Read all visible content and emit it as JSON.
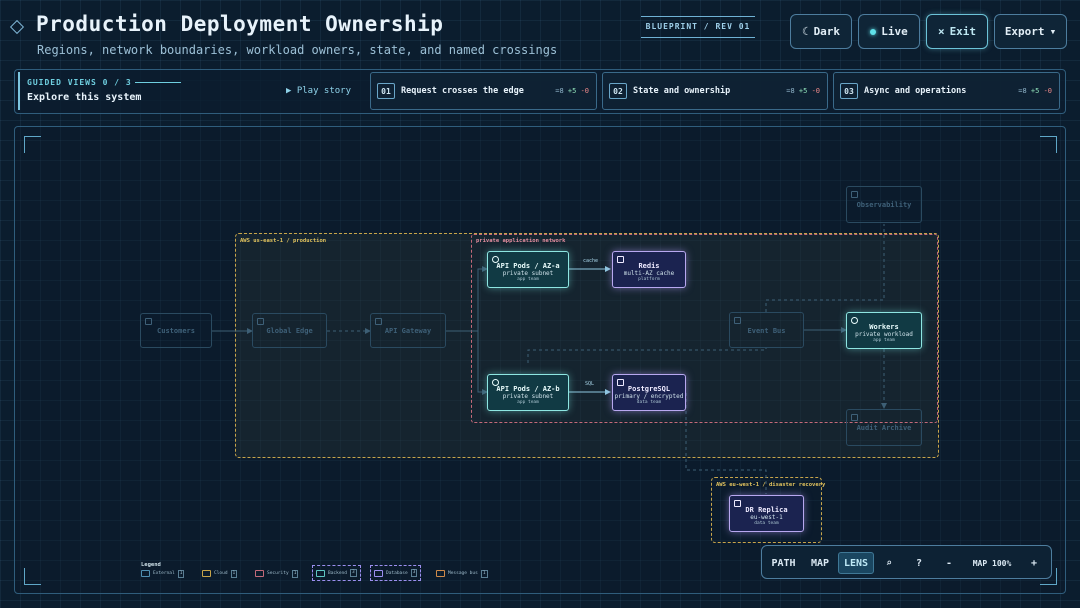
{
  "header": {
    "title": "Production Deployment Ownership",
    "subtitle": "Regions, network boundaries, workload owners, state, and named crossings",
    "revision": "BLUEPRINT / REV 01",
    "buttons": {
      "dark": "Dark",
      "dark_icon": "☾",
      "live": "Live",
      "exit": "Exit",
      "exit_icon": "×",
      "export": "Export",
      "export_icon": "▾"
    }
  },
  "guided": {
    "label": "GUIDED VIEWS 0 / 3",
    "heading": "Explore this system",
    "play": "▶ Play story",
    "steps": [
      {
        "num": "01",
        "label": "Request crosses the edge",
        "eq": "=8",
        "plus": "+5",
        "minus": "-0"
      },
      {
        "num": "02",
        "label": "State and ownership",
        "eq": "=8",
        "plus": "+5",
        "minus": "-0"
      },
      {
        "num": "03",
        "label": "Async and operations",
        "eq": "=8",
        "plus": "+5",
        "minus": "-0"
      }
    ]
  },
  "diagram": {
    "regions": {
      "us_east": "AWS us-east-1 / production",
      "eu_west": "AWS eu-west-1 / disaster recovery",
      "private_net": "private application network"
    },
    "nodes": {
      "customers": {
        "title": "Customers"
      },
      "global_edge": {
        "title": "Global Edge"
      },
      "api_gateway": {
        "title": "API Gateway"
      },
      "api_pods_a": {
        "title": "API Pods / AZ-a",
        "sub": "private subnet",
        "owner": "app team"
      },
      "redis": {
        "title": "Redis",
        "sub": "multi-AZ cache",
        "owner": "platform"
      },
      "api_pods_b": {
        "title": "API Pods / AZ-b",
        "sub": "private subnet",
        "owner": "app team"
      },
      "postgres": {
        "title": "PostgreSQL",
        "sub": "primary / encrypted",
        "owner": "data team"
      },
      "event_bus": {
        "title": "Event Bus"
      },
      "workers": {
        "title": "Workers",
        "sub": "private workload",
        "owner": "app team"
      },
      "observability": {
        "title": "Observability"
      },
      "audit_archive": {
        "title": "Audit Archive"
      },
      "dr_replica": {
        "title": "DR Replica",
        "sub": "eu-west-1",
        "owner": "data team"
      }
    },
    "edges": {
      "cache": "cache",
      "sql": "SQL"
    }
  },
  "legend": {
    "title": "Legend",
    "items": [
      {
        "label": "External",
        "count": "1",
        "color": "#4f8fb3"
      },
      {
        "label": "Cloud",
        "count": "1",
        "color": "#c8a54a"
      },
      {
        "label": "Security",
        "count": "1",
        "color": "#c46a7a"
      },
      {
        "label": "Backend",
        "count": "3",
        "color": "#5fc7c4"
      },
      {
        "label": "Database",
        "count": "3",
        "color": "#9c8ff0"
      },
      {
        "label": "Message bus",
        "count": "1",
        "color": "#d08a4a"
      }
    ]
  },
  "toolbar": {
    "path": "PATH",
    "map": "MAP",
    "lens": "LENS",
    "search_icon": "⌕",
    "help": "?",
    "zoom_out": "-",
    "zoom_label": "MAP 100%",
    "zoom_in": "+"
  }
}
